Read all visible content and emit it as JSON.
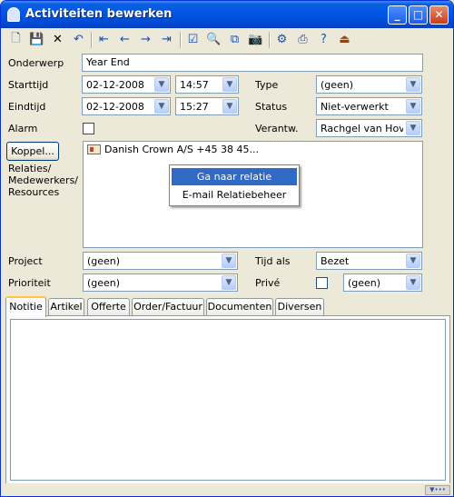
{
  "window": {
    "title": "Activiteiten bewerken",
    "accent_color": "#0055e5"
  },
  "toolbar": {
    "buttons": [
      "new-document-icon",
      "save-icon",
      "delete-icon",
      "undo-icon",
      "first-record-icon",
      "previous-record-icon",
      "next-record-icon",
      "last-record-icon",
      "check-icon",
      "search-icon",
      "copy-icon",
      "camera-icon",
      "settings-icon",
      "print-icon",
      "help-icon",
      "exit-icon"
    ]
  },
  "form": {
    "onderwerp_label": "Onderwerp",
    "onderwerp_value": "Year End",
    "starttijd_label": "Starttijd",
    "start_date": "02-12-2008",
    "start_time": "14:57",
    "eindtijd_label": "Eindtijd",
    "end_date": "02-12-2008",
    "end_time": "15:27",
    "alarm_label": "Alarm",
    "alarm_checked": false,
    "type_label": "Type",
    "type_value": "(geen)",
    "status_label": "Status",
    "status_value": "Niet-verwerkt",
    "verantw_label": "Verantw.",
    "verantw_value": "Rachgel van  Hove",
    "koppel_button": "Koppel...",
    "relaties_label_1": "Relaties/",
    "relaties_label_2": "Medewerkers/",
    "relaties_label_3": "Resources",
    "relation_item": "Danish Crown A/S +45 38 45...",
    "project_label": "Project",
    "project_value": "(geen)",
    "prioriteit_label": "Prioriteit",
    "prioriteit_value": "(geen)",
    "tijd_als_label": "Tijd als",
    "tijd_als_value": "Bezet",
    "prive_label": "Privé",
    "prive_checked": false,
    "prive_value": "(geen)"
  },
  "context_menu": {
    "items": [
      "Ga naar relatie",
      "E-mail Relatiebeheer"
    ],
    "selected_index": 0
  },
  "tabs": {
    "items": [
      "Notitie",
      "Artikel",
      "Offerte",
      "Order/Factuur",
      "Documenten",
      "Diversen"
    ],
    "active_index": 0
  }
}
